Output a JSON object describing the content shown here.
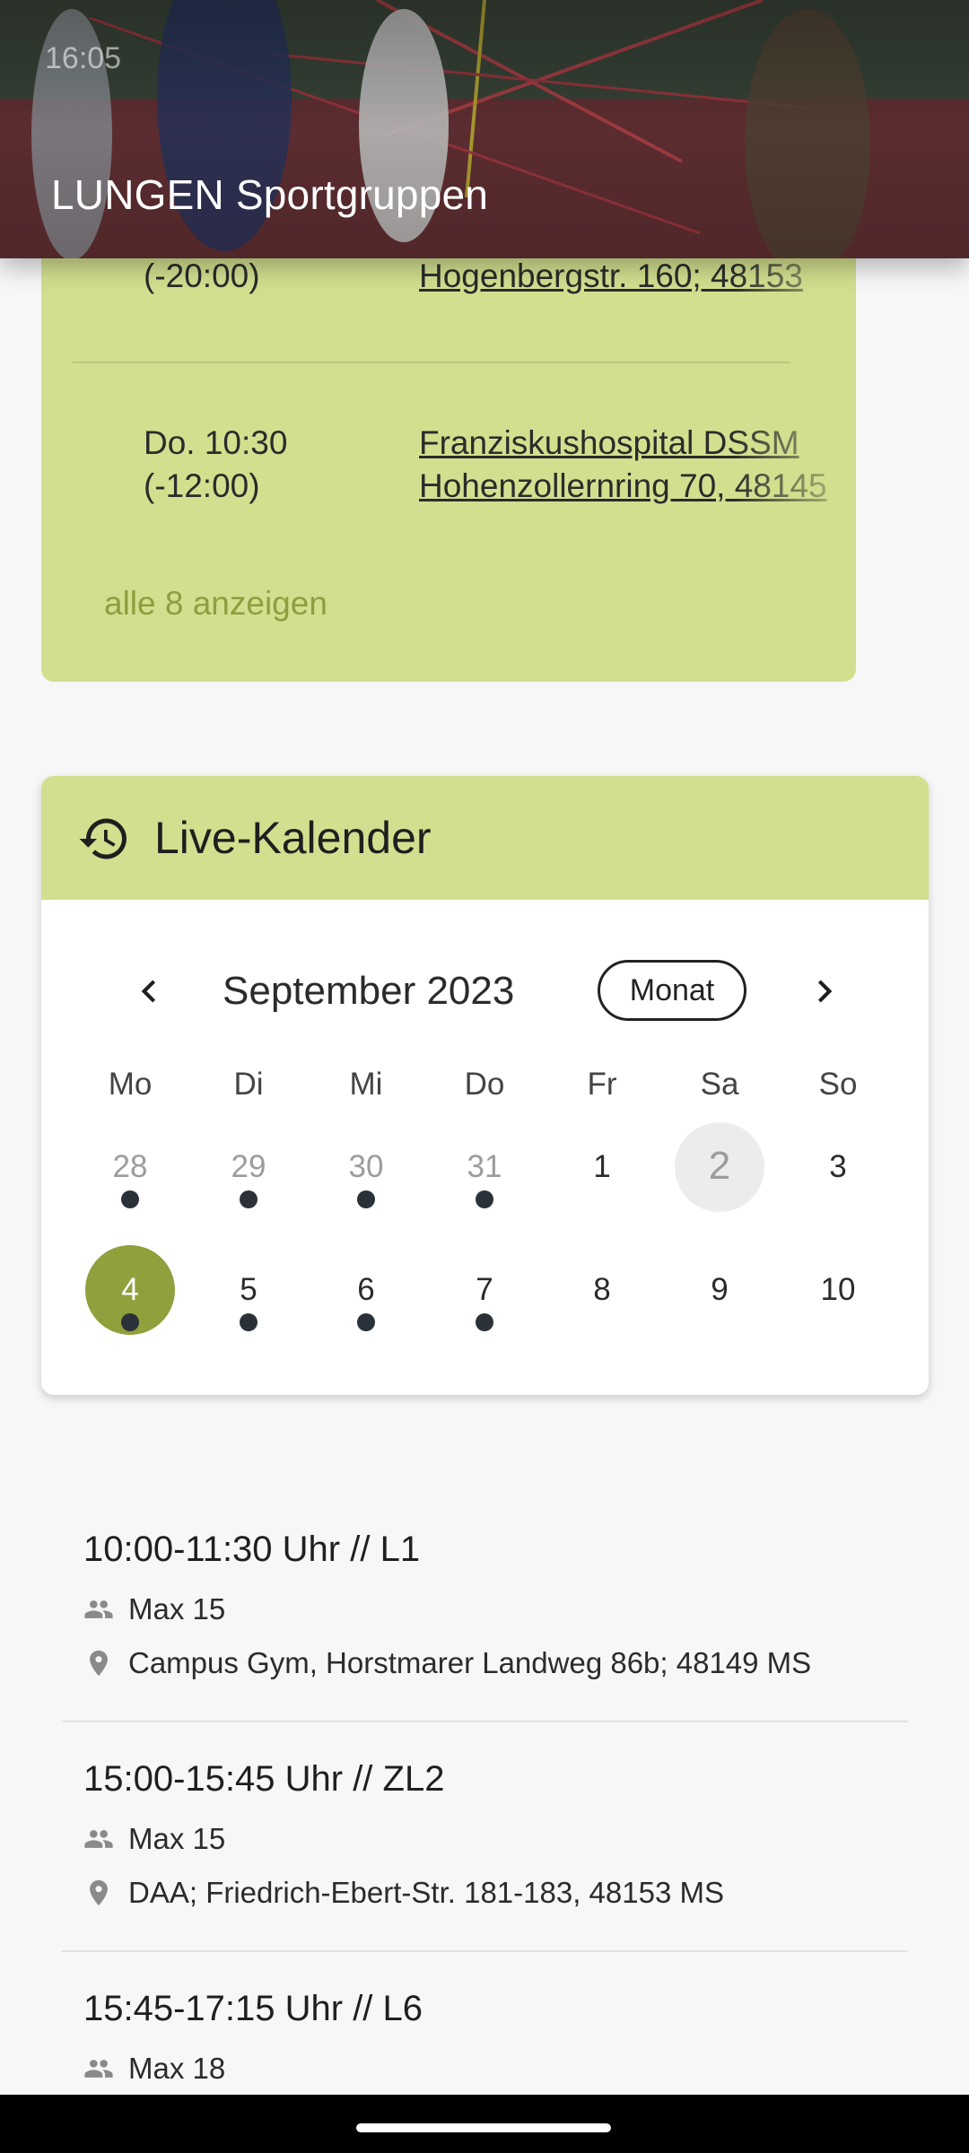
{
  "status": {
    "time": "16:05"
  },
  "header": {
    "title": "LUNGEN Sportgruppen"
  },
  "locations_card": {
    "rows": [
      {
        "time": "(-20:00)",
        "address": "Hogenbergstr. 160; 48153"
      },
      {
        "time": "Do. 10:30\n(-12:00)",
        "address": "Franziskushospital DSSM\nHohenzollernring 70, 48145"
      }
    ],
    "show_all": "alle 8 anzeigen"
  },
  "calendar": {
    "title": "Live-Kalender",
    "month_label": "September 2023",
    "view_button": "Monat",
    "weekdays": [
      "Mo",
      "Di",
      "Mi",
      "Do",
      "Fr",
      "Sa",
      "So"
    ],
    "weeks": [
      [
        {
          "day": "28",
          "muted": true,
          "dot": true
        },
        {
          "day": "29",
          "muted": true,
          "dot": true
        },
        {
          "day": "30",
          "muted": true,
          "dot": true
        },
        {
          "day": "31",
          "muted": true,
          "dot": true
        },
        {
          "day": "1",
          "muted": false,
          "dot": false
        },
        {
          "day": "2",
          "muted": false,
          "dot": false,
          "selected": true
        },
        {
          "day": "3",
          "muted": false,
          "dot": false
        }
      ],
      [
        {
          "day": "4",
          "muted": false,
          "dot": true,
          "today": true
        },
        {
          "day": "5",
          "muted": false,
          "dot": true
        },
        {
          "day": "6",
          "muted": false,
          "dot": true
        },
        {
          "day": "7",
          "muted": false,
          "dot": true
        },
        {
          "day": "8",
          "muted": false,
          "dot": false
        },
        {
          "day": "9",
          "muted": false,
          "dot": false
        },
        {
          "day": "10",
          "muted": false,
          "dot": false
        }
      ]
    ],
    "colors": {
      "accent": "#d3df8f",
      "today": "#8fa03d",
      "dot": "#2b3138"
    }
  },
  "events": [
    {
      "title": "10:00-11:30 Uhr // L1",
      "capacity": "Max 15",
      "location": "Campus Gym, Horstmarer Landweg 86b; 48149 MS"
    },
    {
      "title": "15:00-15:45 Uhr // ZL2",
      "capacity": "Max 15",
      "location": "DAA; Friedrich-Ebert-Str. 181-183, 48153 MS"
    },
    {
      "title": "15:45-17:15 Uhr // L6",
      "capacity": "Max 18",
      "location": ""
    }
  ],
  "icons": {
    "calendar_header": "history-icon",
    "people": "group-icon",
    "location": "location-pin-icon"
  }
}
